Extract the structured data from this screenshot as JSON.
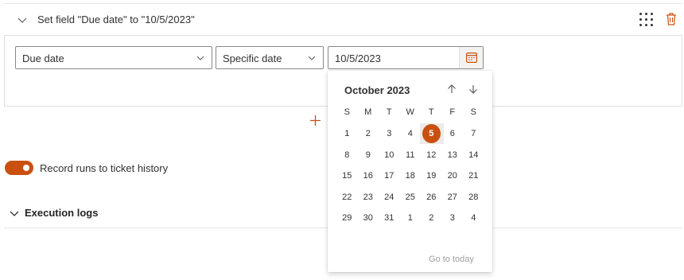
{
  "section": {
    "title": "Set field \"Due date\" to \"10/5/2023\""
  },
  "fields": {
    "field_select": "Due date",
    "mode_select": "Specific date",
    "date_value": "10/5/2023"
  },
  "toggle": {
    "label": "Record runs to ticket history",
    "on": true
  },
  "logs": {
    "title": "Execution logs"
  },
  "calendar": {
    "month_label": "October 2023",
    "weekdays": [
      "S",
      "M",
      "T",
      "W",
      "T",
      "F",
      "S"
    ],
    "weeks": [
      [
        "1",
        "2",
        "3",
        "4",
        "5",
        "6",
        "7"
      ],
      [
        "8",
        "9",
        "10",
        "11",
        "12",
        "13",
        "14"
      ],
      [
        "15",
        "16",
        "17",
        "18",
        "19",
        "20",
        "21"
      ],
      [
        "22",
        "23",
        "24",
        "25",
        "26",
        "27",
        "28"
      ],
      [
        "29",
        "30",
        "31",
        "1",
        "2",
        "3",
        "4"
      ]
    ],
    "selected_day": "5",
    "go_to_today": "Go to today"
  },
  "colors": {
    "accent": "#ca5010",
    "text": "#323130",
    "border": "#8a8886"
  }
}
